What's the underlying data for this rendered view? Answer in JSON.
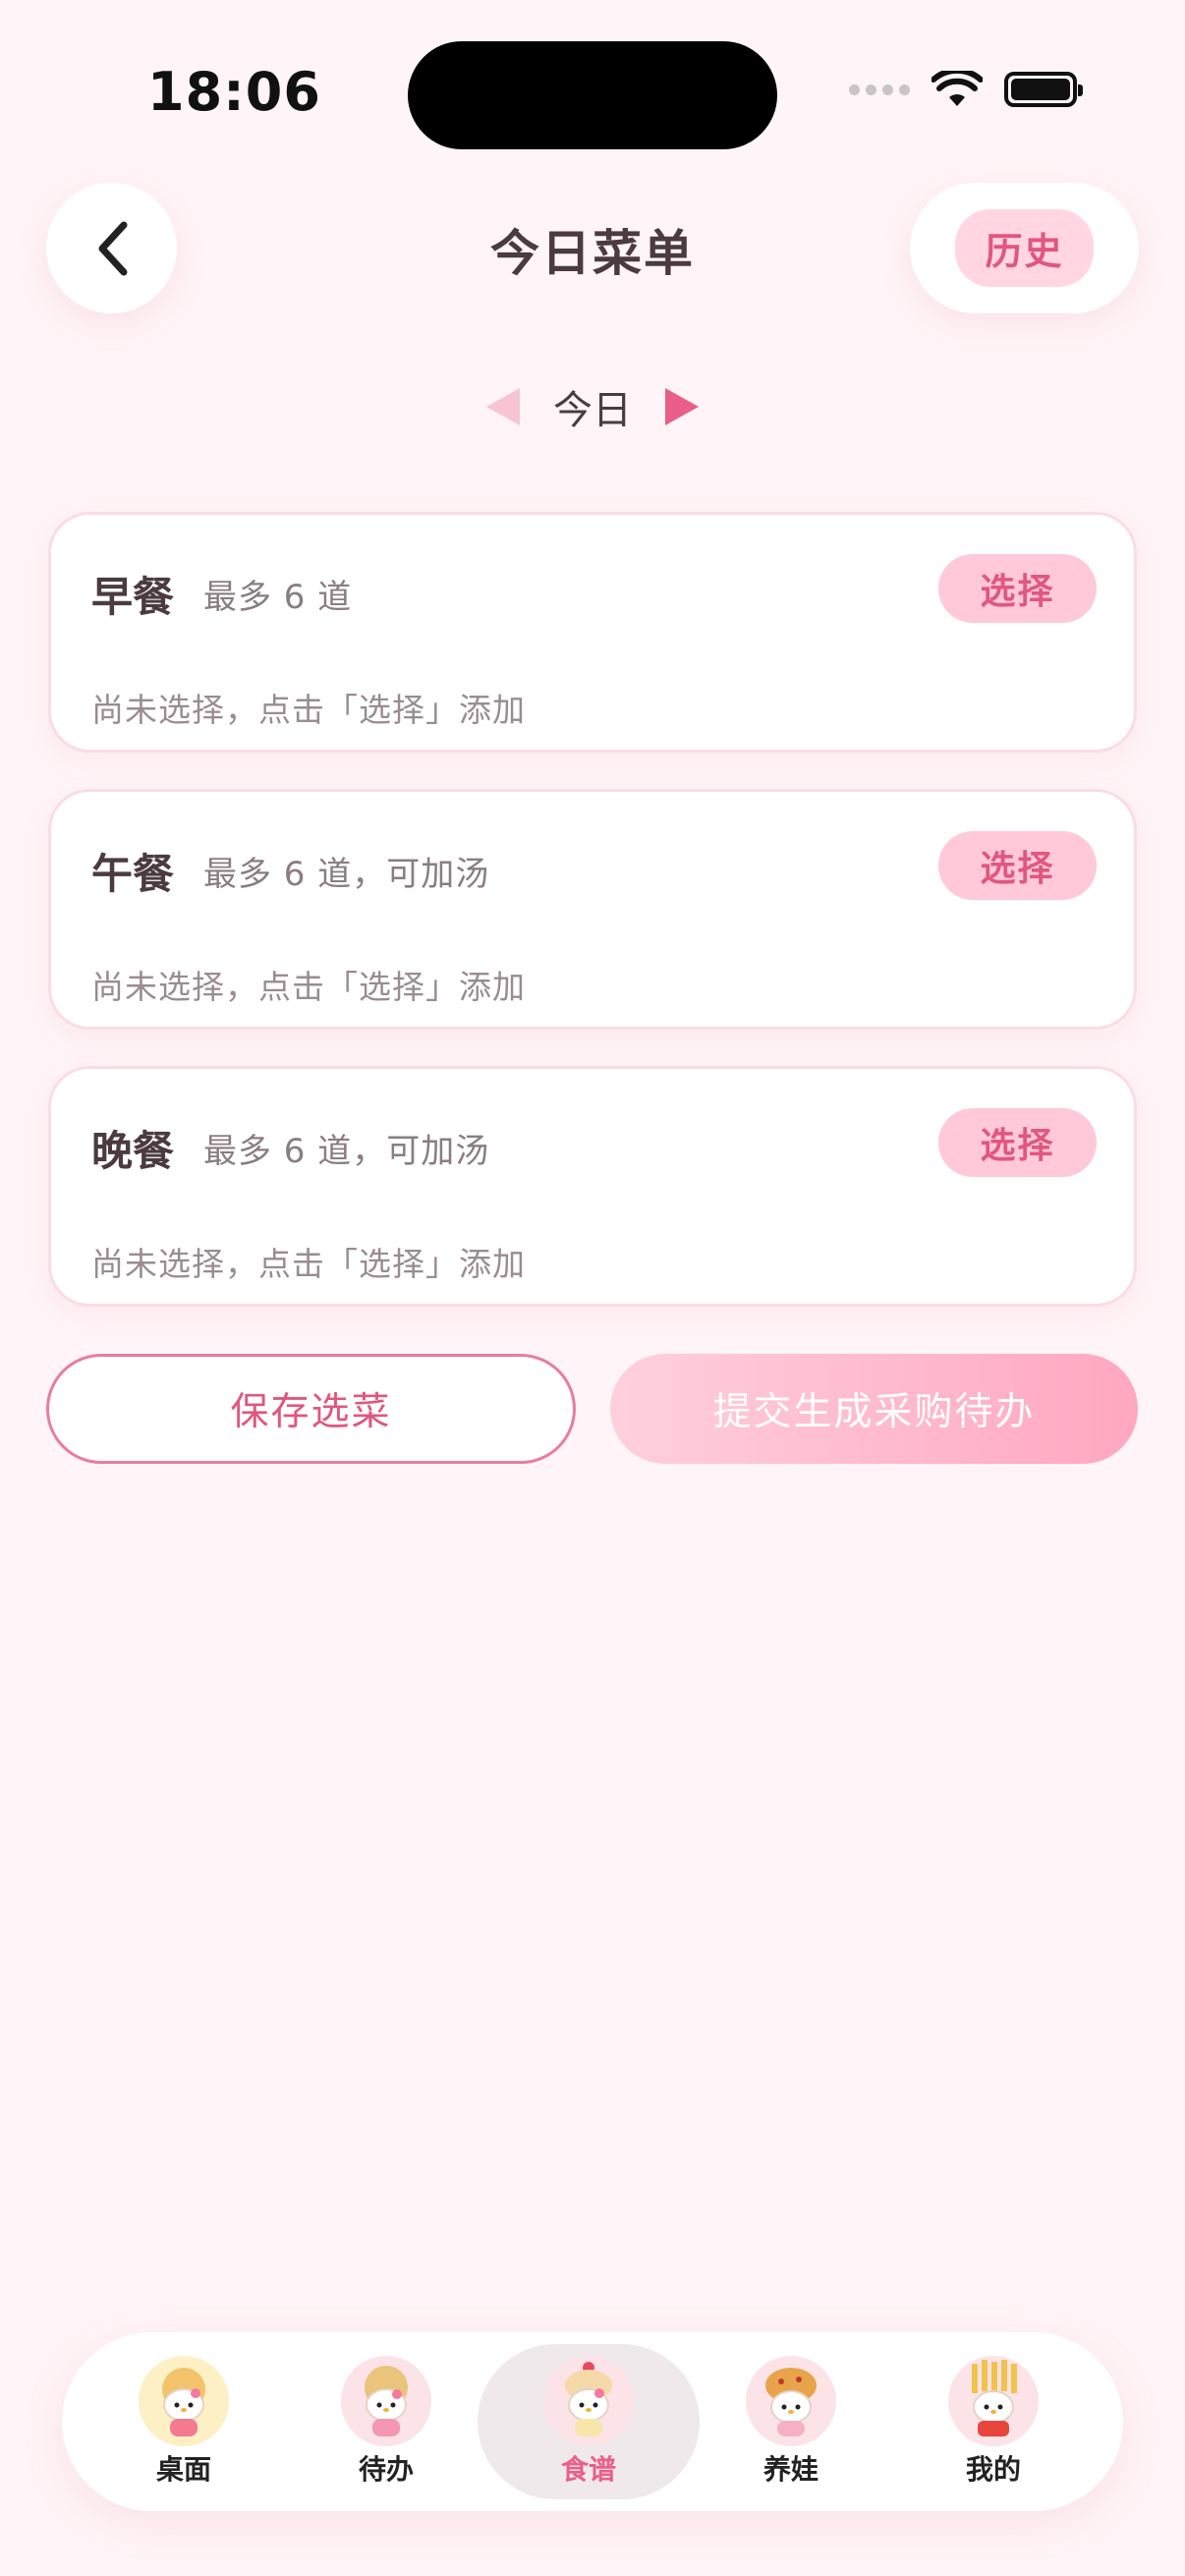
{
  "status": {
    "time": "18:06"
  },
  "header": {
    "title": "今日菜单",
    "history_label": "历史"
  },
  "date_nav": {
    "label": "今日"
  },
  "meals": [
    {
      "name": "早餐",
      "hint": "最多 6 道",
      "select_label": "选择",
      "empty_text": "尚未选择，点击「选择」添加"
    },
    {
      "name": "午餐",
      "hint": "最多 6 道，可加汤",
      "select_label": "选择",
      "empty_text": "尚未选择，点击「选择」添加"
    },
    {
      "name": "晚餐",
      "hint": "最多 6 道，可加汤",
      "select_label": "选择",
      "empty_text": "尚未选择，点击「选择」添加"
    }
  ],
  "actions": {
    "save_label": "保存选菜",
    "submit_label": "提交生成采购待办"
  },
  "tabbar": {
    "active": "食谱",
    "items": [
      {
        "label": "桌面",
        "icon": "character-desktop-icon"
      },
      {
        "label": "待办",
        "icon": "character-todo-icon"
      },
      {
        "label": "食谱",
        "icon": "character-recipe-icon"
      },
      {
        "label": "养娃",
        "icon": "character-parenting-icon"
      },
      {
        "label": "我的",
        "icon": "character-profile-icon"
      }
    ]
  },
  "colors": {
    "accent": "#e0577f",
    "background": "#fff4f7",
    "pill": "#ffc9d9"
  }
}
